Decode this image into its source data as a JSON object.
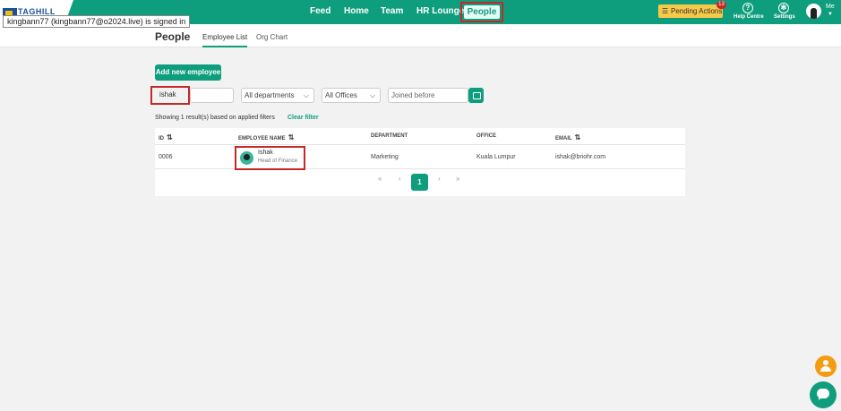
{
  "app": {
    "logo_text": "TAGHILL",
    "signed_in_tooltip": "kingbann77 (kingbann77@o2024.live) is signed in"
  },
  "nav": {
    "items": [
      {
        "label": "Feed"
      },
      {
        "label": "Home"
      },
      {
        "label": "Team"
      },
      {
        "label": "HR Lounge"
      },
      {
        "label": "People",
        "active": true
      }
    ]
  },
  "topbar": {
    "pending_label": "Pending Actions",
    "pending_count": "13",
    "help_label": "Help Centre",
    "settings_label": "Settings",
    "me_label": "Me"
  },
  "page": {
    "title": "People",
    "tabs": [
      {
        "label": "Employee List",
        "active": true
      },
      {
        "label": "Org Chart"
      }
    ]
  },
  "actions": {
    "add_employee_label": "Add new employee"
  },
  "filters": {
    "search_value": "ishak",
    "department_value": "All departments",
    "office_value": "All Offices",
    "joined_placeholder": "Joined before"
  },
  "results": {
    "summary": "Showing 1 result(s) based on applied filters",
    "clear_label": "Clear filter"
  },
  "table": {
    "headers": {
      "id": "ID",
      "name": "EMPLOYEE NAME",
      "department": "DEPARTMENT",
      "office": "OFFICE",
      "email": "EMAIL"
    },
    "rows": [
      {
        "id": "0006",
        "name": "Ishak",
        "role": "Head of Finance",
        "department": "Marketing",
        "office": "Kuala Lumpur",
        "email": "ishak@briohr.com"
      }
    ]
  },
  "pagination": {
    "first": "«",
    "prev": "‹",
    "current": "1",
    "next": "›",
    "last": "»"
  },
  "colors": {
    "brand": "#0f9e7d",
    "highlight": "#c62828",
    "pending": "#f7c948"
  }
}
